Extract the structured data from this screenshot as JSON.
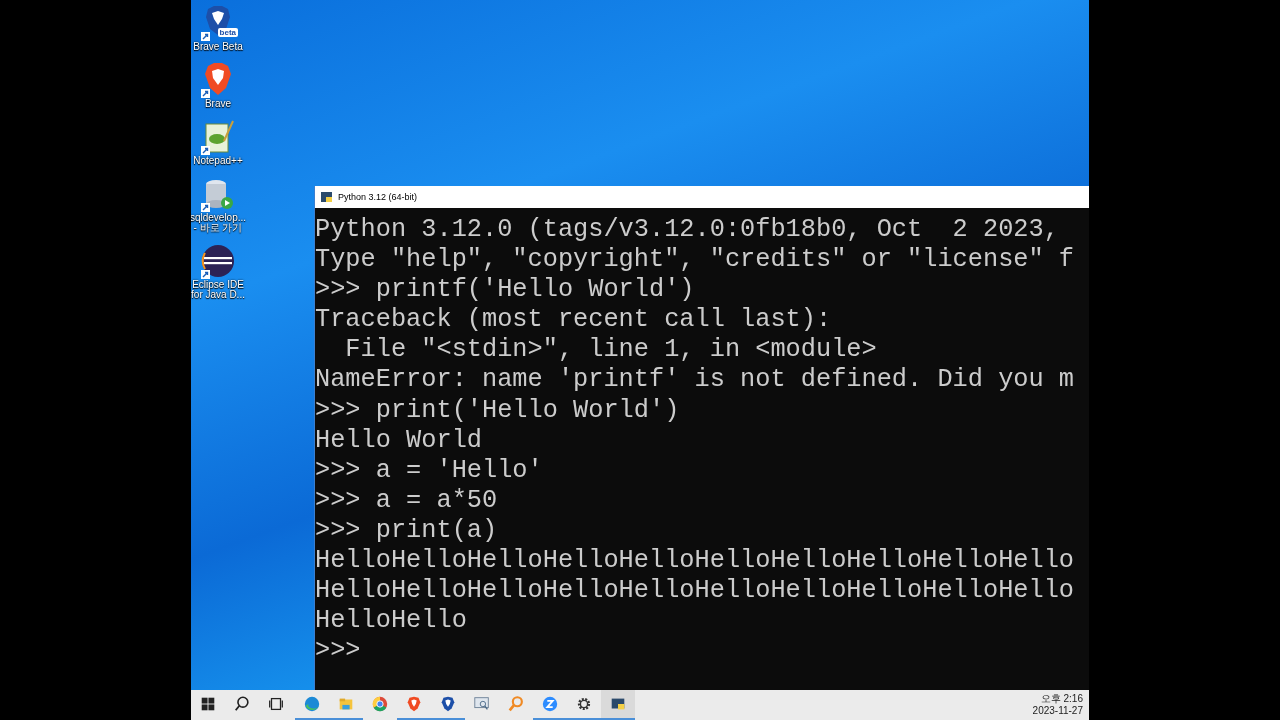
{
  "desktop_icons": [
    {
      "kind": "brave-beta",
      "label": "Brave Beta",
      "badge": "beta"
    },
    {
      "kind": "brave",
      "label": "Brave"
    },
    {
      "kind": "notepad",
      "label": "Notepad++"
    },
    {
      "kind": "database",
      "label": "sqldevelop...\n- 바로 가기"
    },
    {
      "kind": "eclipse",
      "label": "Eclipse IDE\nfor Java D..."
    }
  ],
  "console": {
    "title": "Python 3.12 (64-bit)",
    "lines": [
      "Python 3.12.0 (tags/v3.12.0:0fb18b0, Oct  2 2023,",
      "Type \"help\", \"copyright\", \"credits\" or \"license\" f",
      ">>> printf('Hello World')",
      "Traceback (most recent call last):",
      "  File \"<stdin>\", line 1, in <module>",
      "NameError: name 'printf' is not defined. Did you m",
      ">>> print('Hello World')",
      "Hello World",
      ">>> a = 'Hello'",
      ">>> a = a*50",
      ">>> print(a)",
      "HelloHelloHelloHelloHelloHelloHelloHelloHelloHello",
      "HelloHelloHelloHelloHelloHelloHelloHelloHelloHello",
      "HelloHello",
      ">>>"
    ]
  },
  "taskbar": {
    "apps": [
      {
        "kind": "start",
        "running": false,
        "selected": false
      },
      {
        "kind": "search",
        "running": false,
        "selected": false
      },
      {
        "kind": "taskview",
        "running": false,
        "selected": false
      },
      {
        "kind": "edge",
        "running": true,
        "selected": false
      },
      {
        "kind": "folder",
        "running": true,
        "selected": false
      },
      {
        "kind": "chrome",
        "running": false,
        "selected": false
      },
      {
        "kind": "brave",
        "running": true,
        "selected": false
      },
      {
        "kind": "brave-beta",
        "running": true,
        "selected": false
      },
      {
        "kind": "remote",
        "running": false,
        "selected": false
      },
      {
        "kind": "magnifier",
        "running": false,
        "selected": false
      },
      {
        "kind": "zoom",
        "running": true,
        "selected": false
      },
      {
        "kind": "settings",
        "running": true,
        "selected": false
      },
      {
        "kind": "console",
        "running": true,
        "selected": true
      }
    ],
    "clock": {
      "time": "오후 2:16",
      "date": "2023-11-27"
    }
  }
}
